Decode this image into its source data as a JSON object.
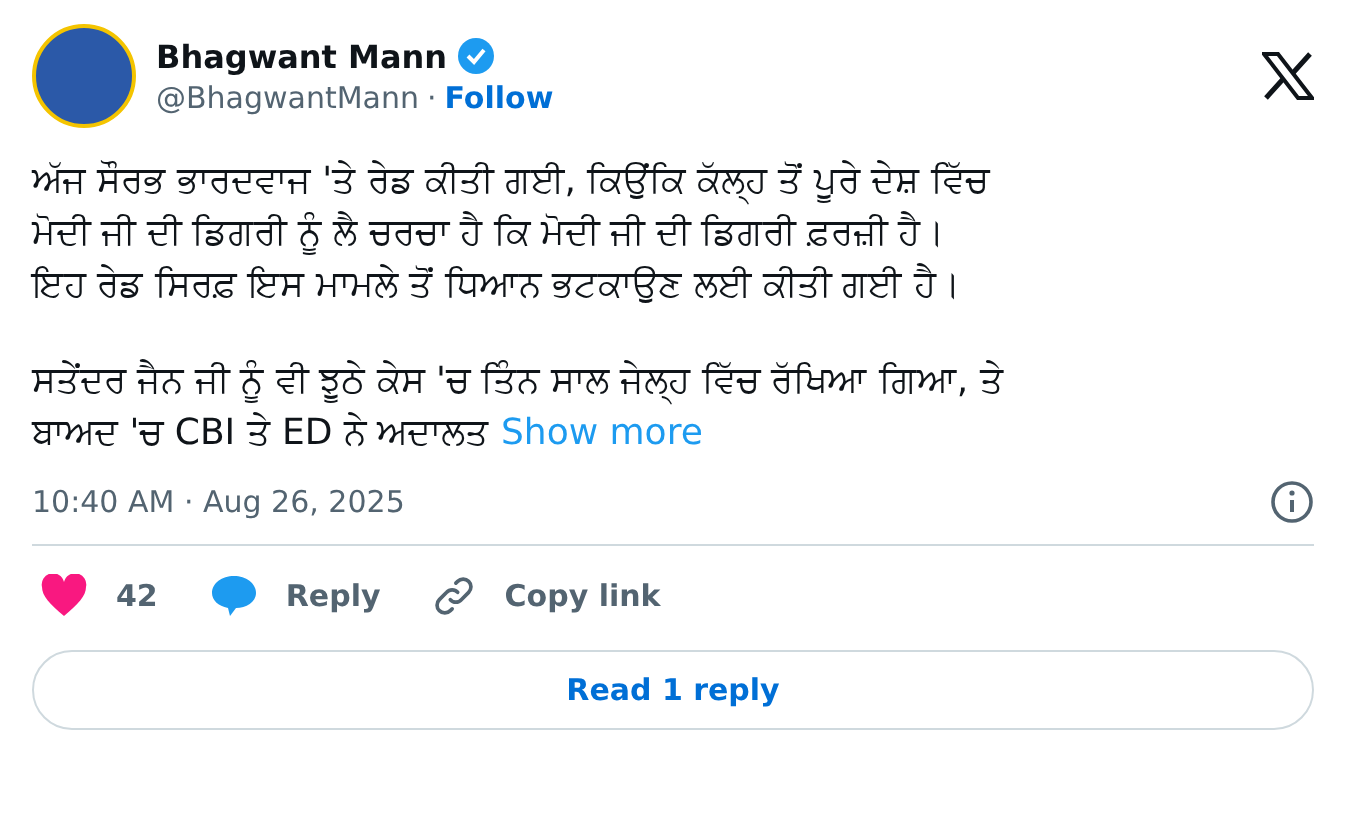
{
  "author": {
    "name": "Bhagwant Mann",
    "verified": true,
    "handle": "@BhagwantMann",
    "separator": "·",
    "follow": "Follow"
  },
  "body": [
    [
      "ਅੱਜ ਸੌਰਭ ਭਾਰਦਵਾਜ 'ਤੇ ਰੇਡ ਕੀਤੀ ਗਈ, ਕਿਉਂਕਿ ਕੱਲ੍ਹ ਤੋਂ ਪੂਰੇ ਦੇਸ਼ ਵਿੱਚ",
      "ਮੋਦੀ ਜੀ ਦੀ ਡਿਗਰੀ ਨੂੰ ਲੈ ਚਰਚਾ ਹੈ ਕਿ ਮੋਦੀ ਜੀ ਦੀ ਡਿਗਰੀ ਫ਼ਰਜ਼ੀ ਹੈ।",
      "ਇਹ ਰੇਡ ਸਿਰਫ਼ ਇਸ ਮਾਮਲੇ ਤੋਂ ਧਿਆਨ ਭਟਕਾਉਣ ਲਈ ਕੀਤੀ ਗਈ ਹੈ।"
    ],
    [
      "ਸਤੇਂਦਰ ਜੈਨ ਜੀ ਨੂੰ ਵੀ ਝੂਠੇ ਕੇਸ 'ਚ ਤਿੰਨ ਸਾਲ ਜੇਲ੍ਹ ਵਿੱਚ ਰੱਖਿਆ ਗਿਆ, ਤੇ",
      "ਬਾਅਦ 'ਚ CBI ਤੇ ED ਨੇ ਅਦਾਲਤ"
    ]
  ],
  "show_more": "Show more",
  "timestamp": "10:40 AM · Aug 26, 2025",
  "actions": [
    {
      "kind": "like",
      "label": "42"
    },
    {
      "kind": "reply",
      "label": "Reply"
    },
    {
      "kind": "link",
      "label": "Copy link"
    }
  ],
  "read_replies": "Read 1 reply"
}
